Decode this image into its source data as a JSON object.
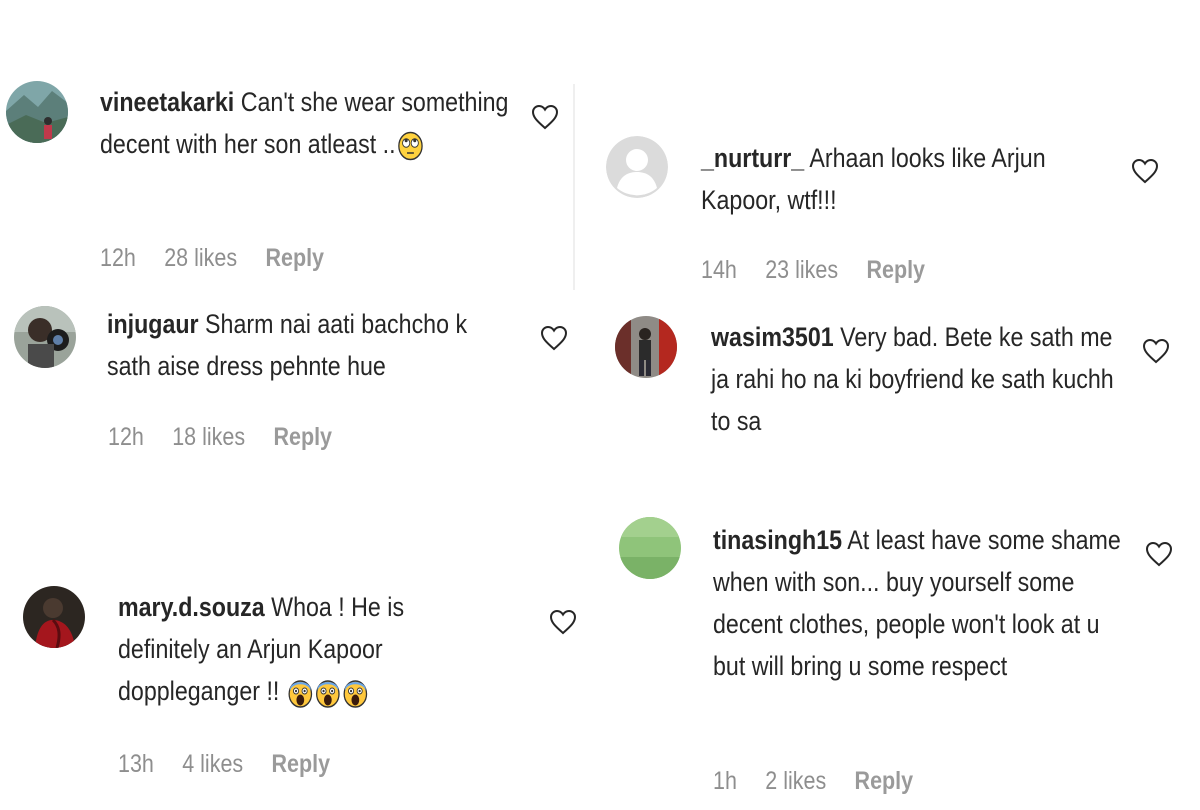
{
  "comments": [
    {
      "username": "vineetakarki",
      "text": "Can't she wear something decent with her son atleast ..",
      "emoji": [
        "eye-roll-emoji"
      ],
      "time": "12h",
      "likes": "28 likes",
      "reply": "Reply"
    },
    {
      "username": "_nurturr_",
      "text": "Arhaan looks like Arjun Kapoor, wtf!!!",
      "time": "14h",
      "likes": "23 likes",
      "reply": "Reply"
    },
    {
      "username": "injugaur",
      "text": "Sharm nai aati bachcho k sath aise dress pehnte hue",
      "time": "12h",
      "likes": "18 likes",
      "reply": "Reply"
    },
    {
      "username": "wasim3501",
      "text": "Very bad. Bete ke sath me ja rahi ho na ki boyfriend ke sath kuchh to sa"
    },
    {
      "username": "mary.d.souza",
      "text": "Whoa ! He is definitely an Arjun Kapoor doppleganger !!",
      "emoji": [
        "screaming-face-emoji",
        "screaming-face-emoji",
        "screaming-face-emoji"
      ],
      "time": "13h",
      "likes": "4 likes",
      "reply": "Reply"
    },
    {
      "username": "tinasingh15",
      "text": "At least have some shame when with son... buy yourself some decent clothes, people won't look at u but will bring u some respect",
      "time": "1h",
      "likes": "2 likes",
      "reply": "Reply"
    }
  ],
  "icons": {
    "like": "heart-outline-icon"
  },
  "colors": {
    "text": "#262626",
    "meta": "#8e8e8e"
  }
}
